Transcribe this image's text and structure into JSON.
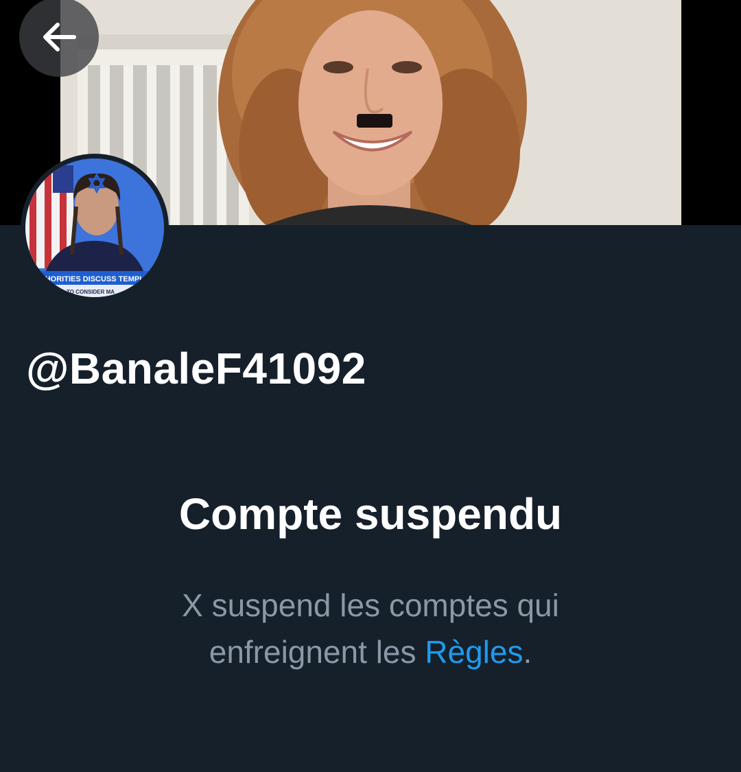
{
  "profile": {
    "handle": "@BanaleF41092",
    "avatar_caption_line1": "THORITIES DISCUSS TEMPL",
    "avatar_caption_line2": "TO CONSIDER MA"
  },
  "navigation": {
    "back_icon": "arrow-left-icon"
  },
  "suspension": {
    "title": "Compte suspendu",
    "line1": "X suspend les comptes qui",
    "line2_prefix": "enfreignent les ",
    "rules_link": "Règles",
    "line2_suffix": "."
  },
  "colors": {
    "background": "#15202b",
    "text_primary": "#ffffff",
    "text_secondary": "#8b98a5",
    "link": "#1d9bf0"
  }
}
